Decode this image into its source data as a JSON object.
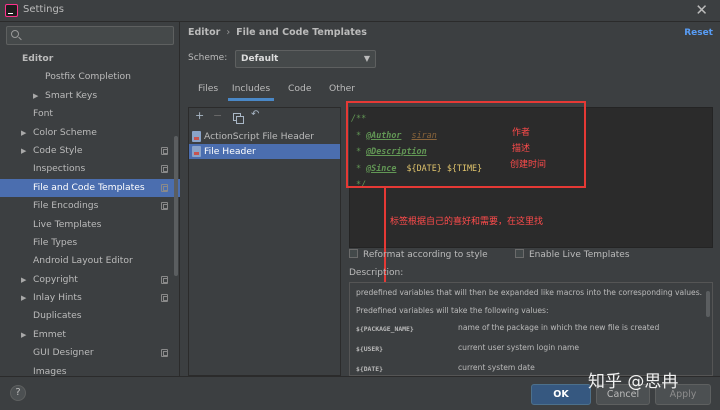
{
  "window": {
    "title": "Settings"
  },
  "search": {
    "placeholder": ""
  },
  "sidebar": {
    "items": [
      {
        "label": "Editor",
        "level": 0,
        "bold": true
      },
      {
        "label": "Postfix Completion",
        "level": 2
      },
      {
        "label": "Smart Keys",
        "level": 2,
        "arrow": true
      },
      {
        "label": "Font",
        "level": 1
      },
      {
        "label": "Color Scheme",
        "level": 1,
        "arrow": true
      },
      {
        "label": "Code Style",
        "level": 1,
        "arrow": true,
        "project": true
      },
      {
        "label": "Inspections",
        "level": 1,
        "project": true
      },
      {
        "label": "File and Code Templates",
        "level": 1,
        "project": true,
        "selected": true
      },
      {
        "label": "File Encodings",
        "level": 1,
        "project": true
      },
      {
        "label": "Live Templates",
        "level": 1
      },
      {
        "label": "File Types",
        "level": 1
      },
      {
        "label": "Android Layout Editor",
        "level": 1
      },
      {
        "label": "Copyright",
        "level": 1,
        "arrow": true,
        "project": true
      },
      {
        "label": "Inlay Hints",
        "level": 1,
        "arrow": true,
        "project": true
      },
      {
        "label": "Duplicates",
        "level": 1
      },
      {
        "label": "Emmet",
        "level": 1,
        "arrow": true
      },
      {
        "label": "GUI Designer",
        "level": 1,
        "project": true
      },
      {
        "label": "Images",
        "level": 1
      }
    ]
  },
  "header": {
    "breadcrumb_root": "Editor",
    "breadcrumb_sep": "›",
    "breadcrumb_page": "File and Code Templates",
    "reset": "Reset"
  },
  "scheme": {
    "label": "Scheme:",
    "value": "Default"
  },
  "tabs": [
    "Files",
    "Includes",
    "Code",
    "Other"
  ],
  "templates": [
    {
      "label": "ActionScript File Header"
    },
    {
      "label": "File Header",
      "selected": true
    }
  ],
  "editor": {
    "open": "/**",
    "author_tag": "@Author",
    "author_val": "siran",
    "desc_tag": "@Description",
    "since_tag": "@Since",
    "since_val1": "${DATE}",
    "since_val2": "${TIME}",
    "close": "*/",
    "star": "*"
  },
  "annotations": {
    "author": "作者",
    "description": "描述",
    "since": "创建时间",
    "note": "标签根据自己的喜好和需要，在这里找"
  },
  "options": {
    "reformat": "Reformat according to style",
    "live_templates": "Enable Live Templates"
  },
  "description": {
    "label": "Description:",
    "line1": "predefined variables that will then be expanded like macros into the corresponding values.",
    "line2": "Predefined variables will take the following values:",
    "vars": [
      {
        "name": "${PACKAGE_NAME}",
        "text": "name of the package in which the new file is created"
      },
      {
        "name": "${USER}",
        "text": "current user system login name"
      },
      {
        "name": "${DATE}",
        "text": "current system date"
      }
    ]
  },
  "buttons": {
    "ok": "OK",
    "cancel": "Cancel",
    "apply": "Apply",
    "help": "?"
  },
  "watermark": "知乎 @思冉"
}
